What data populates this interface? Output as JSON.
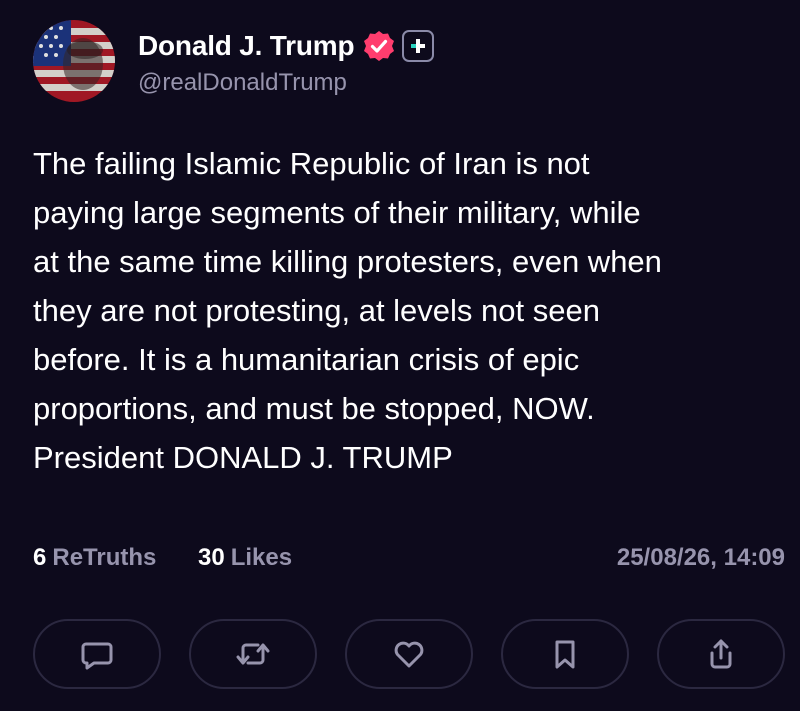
{
  "author": {
    "display_name": "Donald J. Trump",
    "handle": "@realDonaldTrump",
    "verified_icon": "verified-badge-icon",
    "plus_icon": "plus-badge-icon",
    "badge_color": "#ff3d6e"
  },
  "post": {
    "lines": [
      "The failing Islamic Republic of Iran is not",
      "paying large segments of their military, while",
      "at the same time killing protesters, even when",
      "they are not protesting, at levels not seen",
      "before. It is a humanitarian crisis of epic",
      "proportions, and must be stopped, NOW.",
      "President DONALD J. TRUMP"
    ]
  },
  "stats": {
    "retruths_count": "6",
    "retruths_label": "ReTruths",
    "likes_count": "30",
    "likes_label": "Likes",
    "timestamp": "25/08/26, 14:09"
  },
  "actions": [
    {
      "icon": "reply-icon"
    },
    {
      "icon": "retruth-icon"
    },
    {
      "icon": "like-icon"
    },
    {
      "icon": "bookmark-icon"
    },
    {
      "icon": "share-icon"
    }
  ],
  "colors": {
    "background": "#0d0a1c",
    "muted_text": "#9794ad",
    "button_border": "#2b2840"
  }
}
